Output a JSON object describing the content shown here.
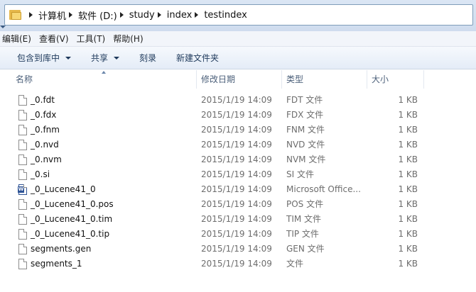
{
  "address_bar": {
    "crumbs": [
      "计算机",
      "软件 (D:)",
      "study",
      "index",
      "testindex"
    ]
  },
  "menubar": {
    "items": [
      "编辑(E)",
      "查看(V)",
      "工具(T)",
      "帮助(H)"
    ]
  },
  "commandbar": {
    "include_library": "包含到库中",
    "share": "共享",
    "burn": "刻录",
    "new_folder": "新建文件夹"
  },
  "columns": {
    "name": "名称",
    "date": "修改日期",
    "type": "类型",
    "size": "大小"
  },
  "files": [
    {
      "name": "_0.fdt",
      "date": "2015/1/19 14:09",
      "type": "FDT 文件",
      "size": "1 KB",
      "icon": "file-icon"
    },
    {
      "name": "_0.fdx",
      "date": "2015/1/19 14:09",
      "type": "FDX 文件",
      "size": "1 KB",
      "icon": "file-icon"
    },
    {
      "name": "_0.fnm",
      "date": "2015/1/19 14:09",
      "type": "FNM 文件",
      "size": "1 KB",
      "icon": "file-icon"
    },
    {
      "name": "_0.nvd",
      "date": "2015/1/19 14:09",
      "type": "NVD 文件",
      "size": "1 KB",
      "icon": "file-icon"
    },
    {
      "name": "_0.nvm",
      "date": "2015/1/19 14:09",
      "type": "NVM 文件",
      "size": "1 KB",
      "icon": "file-icon"
    },
    {
      "name": "_0.si",
      "date": "2015/1/19 14:09",
      "type": "SI 文件",
      "size": "1 KB",
      "icon": "file-icon"
    },
    {
      "name": "_0_Lucene41_0",
      "date": "2015/1/19 14:09",
      "type": "Microsoft Office...",
      "size": "1 KB",
      "icon": "word-document-icon"
    },
    {
      "name": "_0_Lucene41_0.pos",
      "date": "2015/1/19 14:09",
      "type": "POS 文件",
      "size": "1 KB",
      "icon": "file-icon"
    },
    {
      "name": "_0_Lucene41_0.tim",
      "date": "2015/1/19 14:09",
      "type": "TIM 文件",
      "size": "1 KB",
      "icon": "file-icon"
    },
    {
      "name": "_0_Lucene41_0.tip",
      "date": "2015/1/19 14:09",
      "type": "TIP 文件",
      "size": "1 KB",
      "icon": "file-icon"
    },
    {
      "name": "segments.gen",
      "date": "2015/1/19 14:09",
      "type": "GEN 文件",
      "size": "1 KB",
      "icon": "file-icon"
    },
    {
      "name": "segments_1",
      "date": "2015/1/19 14:09",
      "type": "文件",
      "size": "1 KB",
      "icon": "file-icon"
    }
  ]
}
